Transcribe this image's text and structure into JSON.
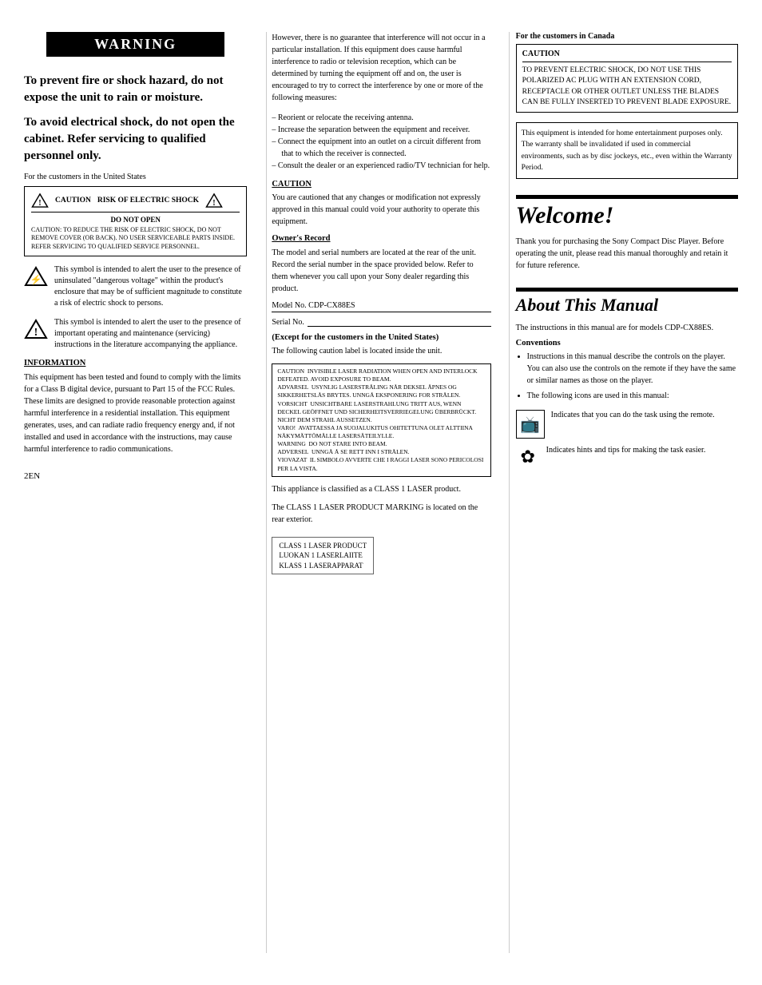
{
  "warning": {
    "box_label": "WARNING",
    "fire_shock_text": "To prevent fire or shock hazard, do not expose the unit to rain or moisture.",
    "electrical_shock_text": "To avoid electrical shock, do not open the cabinet. Refer servicing to qualified personnel only.",
    "us_customers_label": "For the customers in the United States",
    "caution_box_line1": "CAUTION",
    "caution_box_line2": "RISK OF ELECTRIC SHOCK",
    "caution_box_line3": "DO NOT OPEN",
    "caution_box_sub": "CAUTION: TO REDUCE THE RISK OF ELECTRIC SHOCK, DO NOT REMOVE COVER (OR BACK). NO USER SERVICEABLE PARTS INSIDE. REFER SERVICING TO QUALIFIED SERVICE PERSONNEL.",
    "symbol1_text": "This symbol is intended to alert the user to the presence of uninsulated \"dangerous voltage\" within the product's enclosure that may be of sufficient magnitude to constitute a risk of electric shock to persons.",
    "symbol2_text": "This symbol is intended to alert the user to the presence of important operating and maintenance (servicing) instructions in the literature accompanying the appliance.",
    "information_title": "INFORMATION",
    "information_text": "This equipment has been tested and found to comply with the limits for a Class B digital device, pursuant to Part 15 of the FCC Rules. These limits are designed to provide reasonable protection against harmful interference in a residential installation. This equipment generates, uses, and can radiate radio frequency energy and, if not installed and used in accordance with the instructions, may cause harmful interference to radio communications.",
    "page_number": "2EN"
  },
  "col2": {
    "however_text": "However, there is no guarantee that interference will not occur in a particular installation. If this equipment does cause harmful interference to radio or television reception, which can be determined by turning the equipment off and on, the user is encouraged to try to correct the interference by one or more of the following measures:",
    "bullet_items": [
      "Reorient or relocate the receiving antenna.",
      "Increase the separation between the equipment and receiver.",
      "Connect the equipment into an outlet on a circuit different from that to which the receiver is connected.",
      "Consult the dealer or an experienced radio/TV technician for help."
    ],
    "caution_title": "CAUTION",
    "caution_text": "You are cautioned that any changes or modification not expressly approved in this manual could void your authority to operate this equipment.",
    "owners_record_title": "Owner's Record",
    "owners_record_text": "The model and serial numbers are located at the rear of the unit. Record the serial number in the space provided below. Refer to them whenever you call upon your Sony dealer regarding this product.",
    "model_label": "Model No.  CDP-CX88ES",
    "serial_label": "Serial No.",
    "except_us_title": "(Except for the customers in the United States)",
    "except_us_text": "The following caution label is located inside the unit.",
    "caution_label_text": "CAUTION  INVISIBLE LASER RADIATION WHEN OPEN AND INTERLOCK DEFEATED. AVOID EXPOSURE TO BEAM.\nADVARSEL  USYNLIG LASERSTRÅLING NÅR DEKSEL ÅPNES OG SIKKERHETSLÅS BRYTES. UNNGÅ EKSPONERING FOR STRÅLEN.\nVORSICHT  UNSICHTBARE LASERSTRAHLUNG TRITT AUS, WENN DECKEL GEÖFFNET UND SICHERHEITSVERRIEGELUNG ÜBERBRÜCKT. NICHT DEM STRAHL AUSSETZEN.\nVARO!  AVATTAESSA JA SUOJALUKITUS OHITETTUNA OLET ALTTIINA NÄKYMÄTTÖMÄLLE LASERSÄTEILYLLE.\nWARNING  DO NOT STARE INTO BEAM.\nADVERSEL  UNNGÅ Å SE RETT INN I STRÅLEN.\nVIOVAZAT  IL SIMBOLO AVVERTE CHE I RAGGI LASER SONO PERICOLOSI PER LA VISTA.",
    "appliance_text": "This appliance is classified as a CLASS 1 LASER product.",
    "class1_text": "The CLASS 1 LASER PRODUCT MARKING is located on the rear exterior.",
    "class1_label": "CLASS 1 LASER PRODUCT\nLUOKAN 1 LASERLAIITE\nKLASS 1 LASERAPPARAT"
  },
  "col3": {
    "for_canada_label": "For the customers in Canada",
    "caution_header": "CAUTION",
    "caution_canada_text": "TO PREVENT ELECTRIC SHOCK, DO NOT USE THIS POLARIZED AC PLUG WITH AN EXTENSION CORD, RECEPTACLE OR OTHER OUTLET UNLESS THE BLADES CAN BE FULLY INSERTED TO PREVENT BLADE EXPOSURE.",
    "home_entertainment_text": "This equipment is intended for home entertainment purposes only. The warranty shall be invalidated if used in commercial environments, such as by disc jockeys, etc., even within the Warranty Period.",
    "welcome_title": "Welcome!",
    "welcome_text": "Thank you for purchasing the Sony Compact Disc Player. Before operating the unit, please read this manual thoroughly and retain it for future reference.",
    "about_title": "About This Manual",
    "about_text": "The instructions in this manual are for models CDP-CX88ES.",
    "conventions_title": "Conventions",
    "convention_item1": "Instructions in this manual describe the controls on the player. You can also use the controls on the remote if they have the same or similar names as those on the player.",
    "convention_item2": "The following icons are used in this manual:",
    "remote_icon_desc": "Indicates that you can do the task using the remote.",
    "hint_icon_desc": "Indicates hints and tips for making the task easier."
  }
}
